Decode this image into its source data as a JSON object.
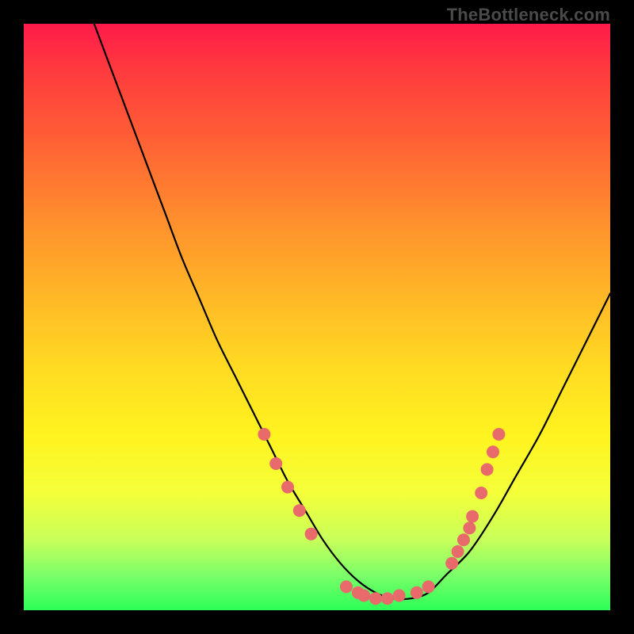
{
  "watermark": "TheBottleneck.com",
  "colors": {
    "background": "#000000",
    "gradient_top": "#ff1a4a",
    "gradient_mid": "#ffd923",
    "gradient_bottom": "#2bff57",
    "curve": "#000000",
    "marker": "#e86a6a"
  },
  "chart_data": {
    "type": "line",
    "title": "",
    "xlabel": "",
    "ylabel": "",
    "xlim": [
      0,
      100
    ],
    "ylim": [
      0,
      100
    ],
    "grid": false,
    "legend": false,
    "series": [
      {
        "name": "bottleneck-curve",
        "x": [
          12,
          15,
          18,
          21,
          24,
          27,
          30,
          33,
          36,
          39,
          42,
          45,
          48,
          51,
          54,
          57,
          60,
          63,
          66,
          69,
          72,
          76,
          80,
          84,
          88,
          92,
          96,
          100
        ],
        "y": [
          100,
          92,
          84,
          76,
          68,
          60,
          53,
          46,
          40,
          34,
          28,
          22,
          17,
          12,
          8,
          5,
          3,
          2,
          2,
          3,
          6,
          10,
          16,
          23,
          30,
          38,
          46,
          54
        ]
      }
    ],
    "markers": [
      {
        "x": 41,
        "y": 30
      },
      {
        "x": 43,
        "y": 25
      },
      {
        "x": 45,
        "y": 21
      },
      {
        "x": 47,
        "y": 17
      },
      {
        "x": 49,
        "y": 13
      },
      {
        "x": 55,
        "y": 4
      },
      {
        "x": 57,
        "y": 3
      },
      {
        "x": 58,
        "y": 2.5
      },
      {
        "x": 60,
        "y": 2
      },
      {
        "x": 62,
        "y": 2
      },
      {
        "x": 64,
        "y": 2.5
      },
      {
        "x": 67,
        "y": 3
      },
      {
        "x": 69,
        "y": 4
      },
      {
        "x": 73,
        "y": 8
      },
      {
        "x": 74,
        "y": 10
      },
      {
        "x": 75,
        "y": 12
      },
      {
        "x": 76,
        "y": 14
      },
      {
        "x": 76.5,
        "y": 16
      },
      {
        "x": 78,
        "y": 20
      },
      {
        "x": 79,
        "y": 24
      },
      {
        "x": 80,
        "y": 27
      },
      {
        "x": 81,
        "y": 30
      }
    ]
  }
}
